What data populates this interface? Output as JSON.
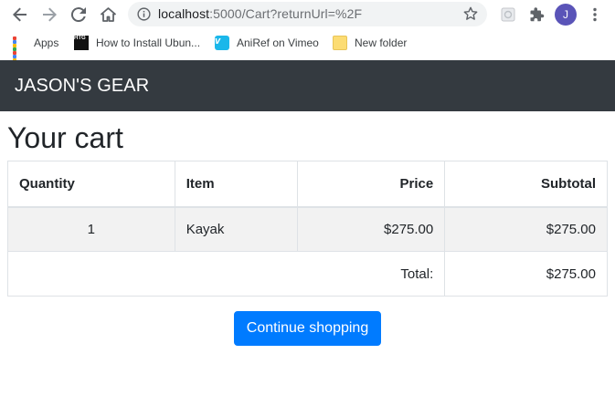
{
  "browser": {
    "url_host": "localhost",
    "url_path": ":5000/Cart?returnUrl=%2F",
    "avatar_initial": "J",
    "icons": [
      "back-icon",
      "forward-icon",
      "reload-icon",
      "home-icon",
      "info-icon",
      "star-icon",
      "extension-icon",
      "puzzle-icon",
      "menu-icon"
    ]
  },
  "bookmarks": [
    {
      "label": "Apps",
      "icon": "apps-grid-icon"
    },
    {
      "label": "How to Install Ubun...",
      "icon": "htg-icon",
      "icon_text": "HTG"
    },
    {
      "label": "AniRef on Vimeo",
      "icon": "vimeo-icon",
      "icon_text": "v"
    },
    {
      "label": "New folder",
      "icon": "folder-icon"
    }
  ],
  "navbar": {
    "brand": "JASON'S GEAR",
    "bg": "#343a40"
  },
  "page": {
    "title": "Your cart"
  },
  "table": {
    "headers": {
      "quantity": "Quantity",
      "item": "Item",
      "price": "Price",
      "subtotal": "Subtotal"
    },
    "rows": [
      {
        "quantity": "1",
        "item": "Kayak",
        "price": "$275.00",
        "subtotal": "$275.00"
      }
    ],
    "total_label": "Total:",
    "total_value": "$275.00"
  },
  "actions": {
    "continue_label": "Continue shopping",
    "accent": "#007bff"
  }
}
